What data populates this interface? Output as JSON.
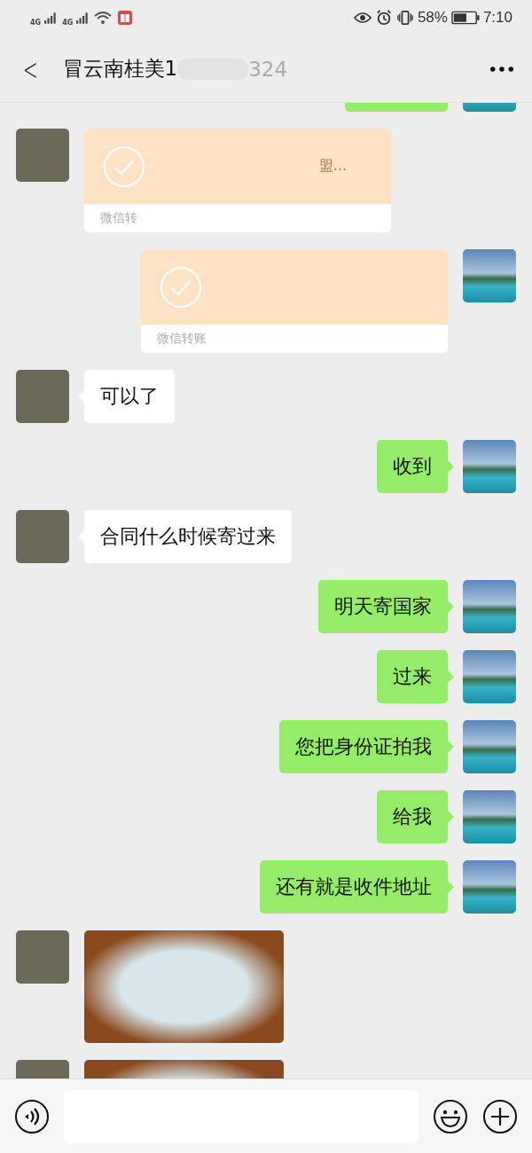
{
  "status_bar": {
    "network_left": "4G",
    "network_right": "4G",
    "battery": "58%",
    "time": "7:10"
  },
  "title_bar": {
    "back": "<",
    "title": "冒云南桂美1",
    "title_end": "324"
  },
  "messages": [
    {
      "kind": "cut",
      "outgoing": true
    },
    {
      "kind": "transfer",
      "outgoing": false,
      "text": "盟...",
      "footer": "微信转"
    },
    {
      "kind": "transfer",
      "outgoing": true,
      "footer": "微信转账"
    },
    {
      "kind": "text",
      "outgoing": false,
      "text": "可以了"
    },
    {
      "kind": "text",
      "outgoing": true,
      "text": "收到"
    },
    {
      "kind": "text",
      "outgoing": false,
      "text": "合同什么时候寄过来"
    },
    {
      "kind": "text",
      "outgoing": true,
      "text": "明天寄国家"
    },
    {
      "kind": "text",
      "outgoing": true,
      "text": "过来"
    },
    {
      "kind": "text",
      "outgoing": true,
      "text": "您把身份证拍我"
    },
    {
      "kind": "text",
      "outgoing": true,
      "text": "给我"
    },
    {
      "kind": "text",
      "outgoing": true,
      "text": "还有就是收件地址"
    },
    {
      "kind": "image",
      "outgoing": false
    },
    {
      "kind": "image",
      "outgoing": false
    }
  ]
}
